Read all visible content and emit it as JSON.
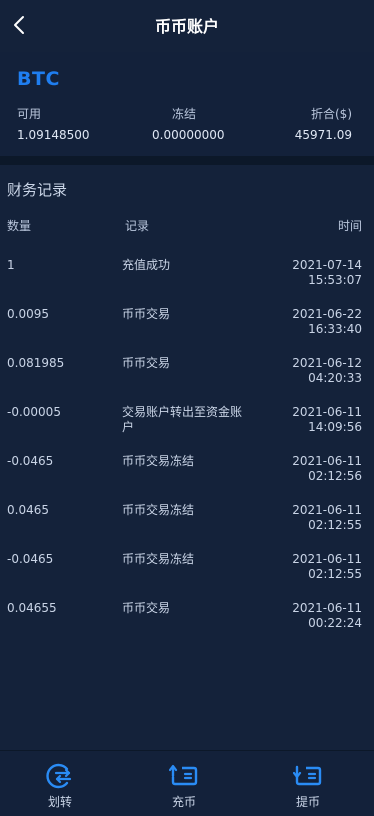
{
  "header": {
    "title": "币币账户"
  },
  "balance": {
    "coin": "BTC",
    "available_label": "可用",
    "available_value": "1.09148500",
    "frozen_label": "冻结",
    "frozen_value": "0.00000000",
    "total_label": "折合($)",
    "total_value": "45971.09"
  },
  "records": {
    "title": "财务记录",
    "headers": {
      "qty": "数量",
      "record": "记录",
      "time": "时间"
    },
    "rows": [
      {
        "qty": "1",
        "desc": "充值成功",
        "date": "2021-07-14",
        "time": "15:53:07"
      },
      {
        "qty": "0.0095",
        "desc": "币币交易",
        "date": "2021-06-22",
        "time": "16:33:40"
      },
      {
        "qty": "0.081985",
        "desc": "币币交易",
        "date": "2021-06-12",
        "time": "04:20:33"
      },
      {
        "qty": "-0.00005",
        "desc": "交易账户转出至资金账户",
        "date": "2021-06-11",
        "time": "14:09:56"
      },
      {
        "qty": "-0.0465",
        "desc": "币币交易冻结",
        "date": "2021-06-11",
        "time": "02:12:56"
      },
      {
        "qty": "0.0465",
        "desc": "币币交易冻结",
        "date": "2021-06-11",
        "time": "02:12:55"
      },
      {
        "qty": "-0.0465",
        "desc": "币币交易冻结",
        "date": "2021-06-11",
        "time": "02:12:55"
      },
      {
        "qty": "0.04655",
        "desc": "币币交易",
        "date": "2021-06-11",
        "time": "00:22:24"
      }
    ]
  },
  "nav": {
    "items": [
      {
        "label": "划转",
        "icon": "transfer-icon"
      },
      {
        "label": "充币",
        "icon": "deposit-icon"
      },
      {
        "label": "提币",
        "icon": "withdraw-icon"
      }
    ]
  },
  "colors": {
    "background": "#14223a",
    "accent": "#1f7ef0",
    "text": "#c9d4e6"
  }
}
